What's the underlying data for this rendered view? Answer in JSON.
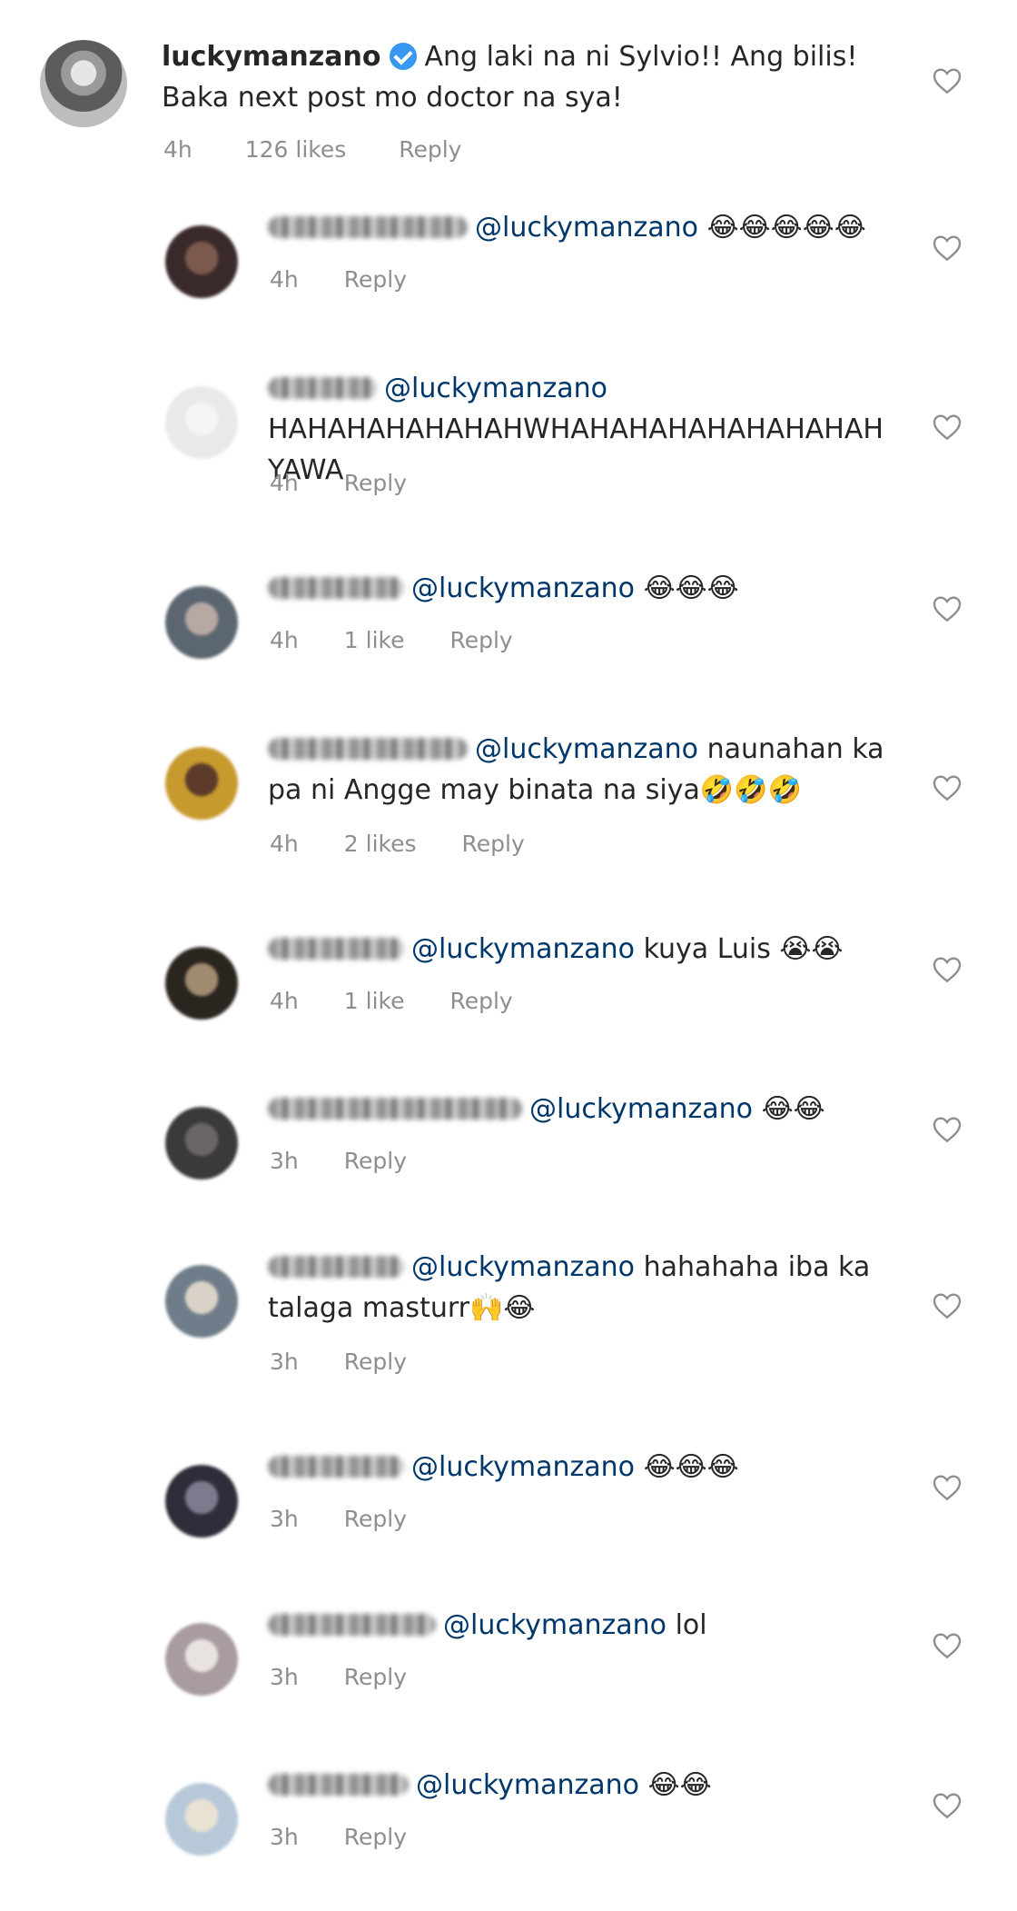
{
  "main_comment": {
    "username": "luckymanzano",
    "text": "Ang laki na ni Sylvio!! Ang bilis! Baka next post mo doctor na sya!",
    "time": "4h",
    "likes": "126 likes",
    "reply_label": "Reply"
  },
  "replies": [
    {
      "mention": "@luckymanzano",
      "text": "😂😂😂😂😂",
      "time": "4h",
      "likes": "",
      "reply_label": "Reply"
    },
    {
      "mention": "@luckymanzano",
      "text": "HAHAHAHAHAHAHWHAHAHAHAHAHAHAHAH YAWA",
      "time": "4h",
      "likes": "",
      "reply_label": "Reply"
    },
    {
      "mention": "@luckymanzano",
      "text": "😂😂😂",
      "time": "4h",
      "likes": "1 like",
      "reply_label": "Reply"
    },
    {
      "mention": "@luckymanzano",
      "text": "naunahan ka pa ni Angge may binata na siya🤣🤣🤣",
      "time": "4h",
      "likes": "2 likes",
      "reply_label": "Reply"
    },
    {
      "mention": "@luckymanzano",
      "text": "kuya Luis 😭😭",
      "time": "4h",
      "likes": "1 like",
      "reply_label": "Reply"
    },
    {
      "mention": "@luckymanzano",
      "text": "😂😂",
      "time": "3h",
      "likes": "",
      "reply_label": "Reply"
    },
    {
      "mention": "@luckymanzano",
      "text": "hahahaha iba ka talaga masturr🙌😂",
      "time": "3h",
      "likes": "",
      "reply_label": "Reply"
    },
    {
      "mention": "@luckymanzano",
      "text": "😂😂😂",
      "time": "3h",
      "likes": "",
      "reply_label": "Reply"
    },
    {
      "mention": "@luckymanzano",
      "text": "lol",
      "time": "3h",
      "likes": "",
      "reply_label": "Reply"
    },
    {
      "mention": "@luckymanzano",
      "text": "😂😂",
      "time": "3h",
      "likes": "",
      "reply_label": "Reply"
    }
  ],
  "icons": {
    "heart": "heart-outline-icon",
    "verified": "verified-badge-icon"
  },
  "colors": {
    "mention": "#00376b",
    "meta": "#8e8e8e",
    "verified": "#3897f0"
  }
}
